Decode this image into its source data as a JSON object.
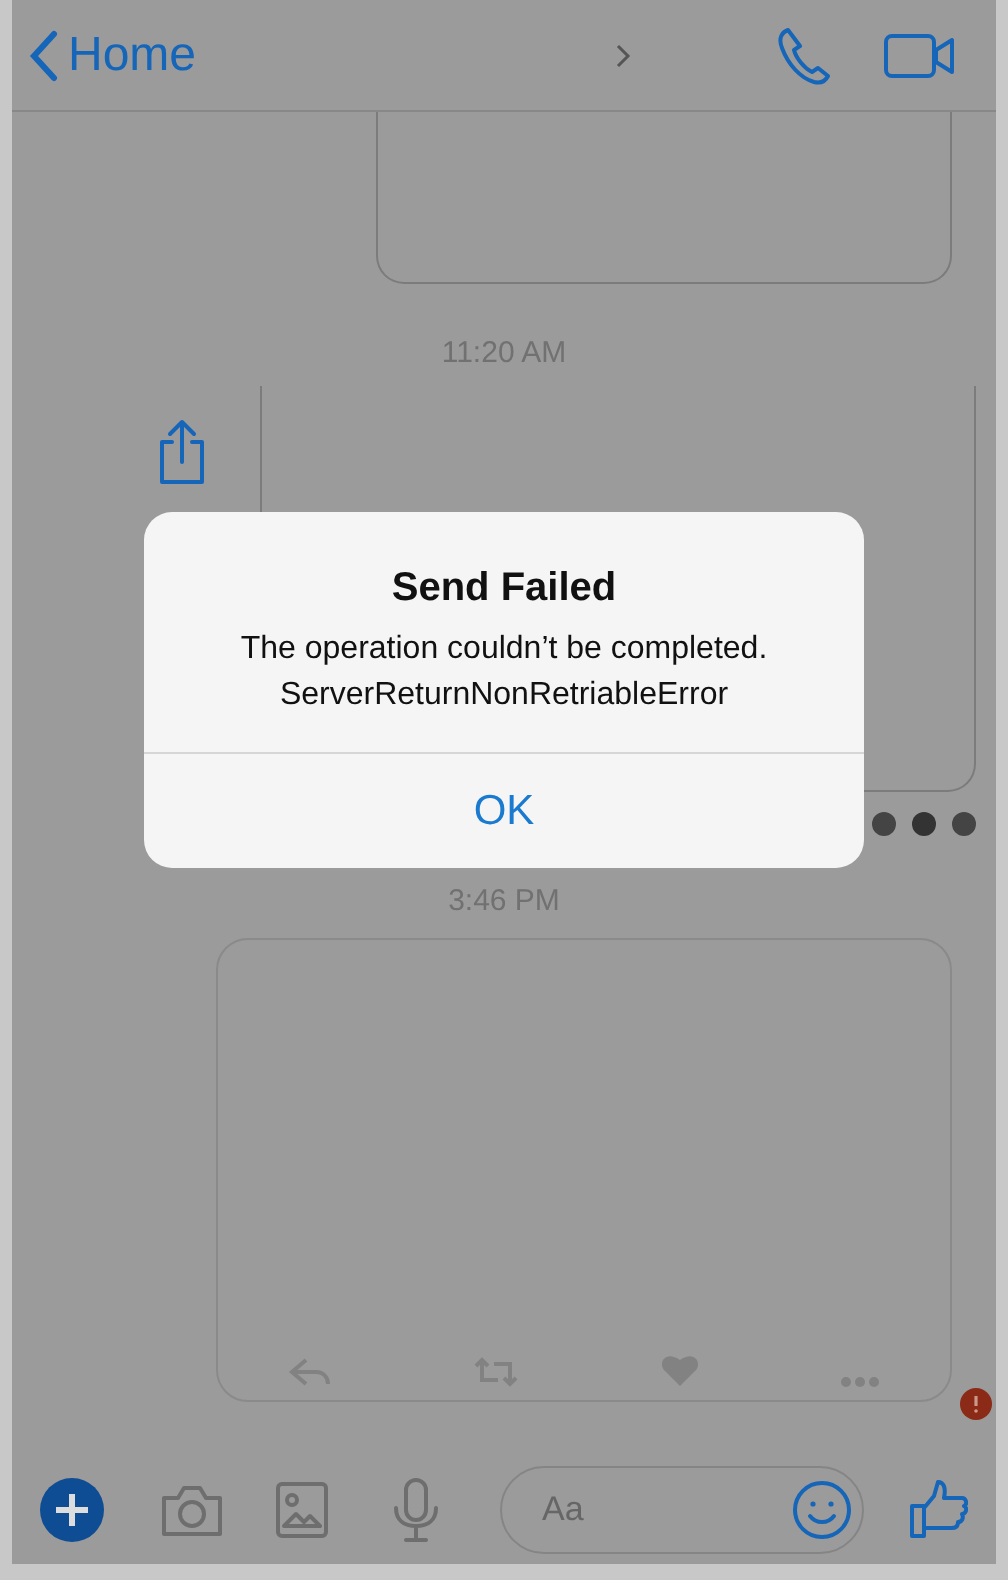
{
  "nav": {
    "back_label": "Home"
  },
  "timestamps": [
    "11:20 AM",
    "3:46 PM"
  ],
  "alert": {
    "title": "Send Failed",
    "message_lines": [
      "The operation couldn’t be completed.",
      "ServerReturnNonRetriableError"
    ],
    "button": "OK"
  },
  "composer": {
    "placeholder": "Aa"
  }
}
